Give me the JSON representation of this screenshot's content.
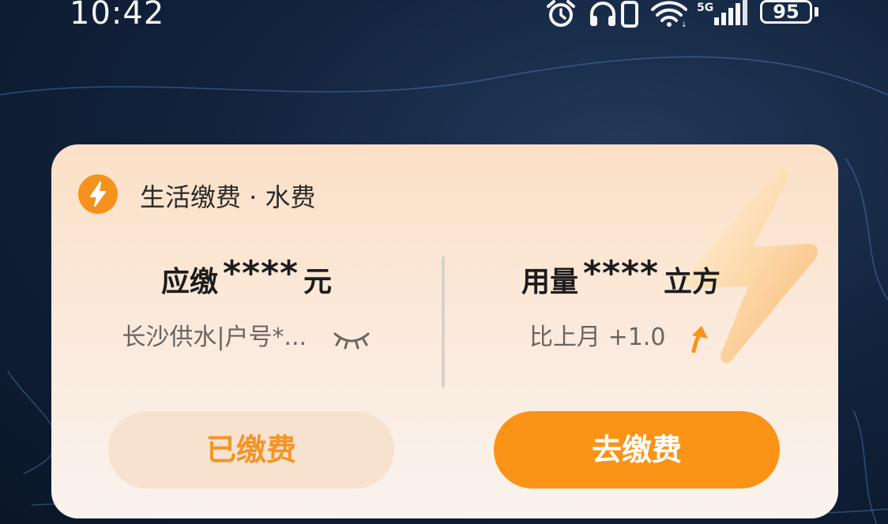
{
  "status_bar": {
    "time": "10:42",
    "network": "5G",
    "battery": "95",
    "icons": [
      "alarm-icon",
      "headphones-icon",
      "vibrate-icon",
      "wifi-icon",
      "signal-icon"
    ]
  },
  "card": {
    "header": {
      "icon": "lightning-bolt-icon",
      "title": "生活缴费 · 水费"
    },
    "amount": {
      "prefix": "应缴",
      "masked_value": "****",
      "unit": "元",
      "account": "长沙供水|户号*...",
      "toggle_icon": "eye-closed-icon"
    },
    "usage": {
      "prefix": "用量",
      "masked_value": "****",
      "unit": "立方",
      "comparison": "比上月 +1.0",
      "trend_icon": "arrow-up-icon"
    },
    "buttons": {
      "paid_label": "已缴费",
      "pay_label": "去缴费"
    }
  },
  "colors": {
    "accent": "#fb9316",
    "card_top": "#fbe0c6",
    "card_bottom": "#f9f3ee",
    "background": "#12233d"
  }
}
